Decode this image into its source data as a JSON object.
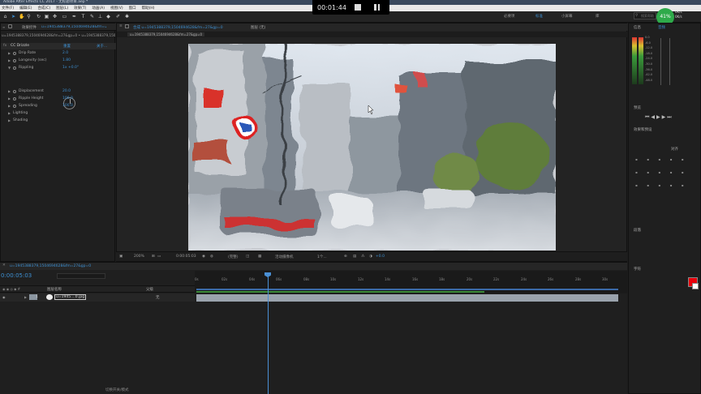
{
  "titlebar": {
    "title": "Adobe After Effects CC 2017 - 无标题项目.aep *"
  },
  "menu": [
    "文件(F)",
    "编辑(E)",
    "合成(C)",
    "图层(L)",
    "效果(T)",
    "动画(A)",
    "视图(V)",
    "窗口",
    "帮助(H)"
  ],
  "recorder": {
    "time": "00:01:44"
  },
  "toolbar": {
    "snap_label": "对齐",
    "workspaces": [
      "必要项",
      "标准",
      "小屏幕",
      "库"
    ],
    "search_placeholder": "搜索帮助"
  },
  "system": {
    "cpu": "41%",
    "net_up": "0K/s",
    "net_down": "0K/s"
  },
  "effect_controls": {
    "tab": "效果控件",
    "tab_file": "u=1945388379,1504694628&fm=27&gp=0",
    "breadcrumb": "u=1945388379,1504694628&fm=27&gp=0 • u=1945388379,1504694628&fm=27&gp=0",
    "effect_name": "CC Drizzle",
    "reset": "重置",
    "about": "关于...",
    "params": [
      {
        "name": "Drip Rate",
        "value": "2.0",
        "twirl": true,
        "stopwatch": true
      },
      {
        "name": "Longevity (sec)",
        "value": "1.80",
        "twirl": true,
        "stopwatch": true
      },
      {
        "name": "Rippling",
        "value": "1x +0.0°",
        "twirl": true,
        "stopwatch": true
      },
      {
        "name": "Displacement",
        "value": "20.0",
        "twirl": true,
        "stopwatch": true
      },
      {
        "name": "Ripple Height",
        "value": "100.0",
        "twirl": true,
        "stopwatch": true
      },
      {
        "name": "Spreading",
        "value": "100.0",
        "twirl": true,
        "stopwatch": true
      },
      {
        "name": "Lighting",
        "value": "",
        "twirl": true,
        "stopwatch": false
      },
      {
        "name": "Shading",
        "value": "",
        "twirl": true,
        "stopwatch": false
      }
    ]
  },
  "composition": {
    "tab": "合成 u=1945388379,1504694628&fm=27&gp=0",
    "layer_tab": "图层 (无)",
    "sub_tab": "u=1945388379,1504694628&fm=27&gp=0",
    "zoom": "200%",
    "timecode": "0:00:05:03",
    "resolution": "(完整)",
    "camera": "活动摄像机",
    "views": "1个...",
    "exposure": "+0.0"
  },
  "timeline": {
    "tab": "u=1945388379,1504694628&fm=27&gp=0",
    "timecode": "0:00:05:03",
    "col_layer": "图层名称",
    "col_parent": "父级",
    "layer": {
      "index": "1",
      "name": "u=1945....0.jpg",
      "parent": "无"
    },
    "ticks": [
      "0s",
      "02s",
      "04s",
      "06s",
      "08s",
      "10s",
      "12s",
      "14s",
      "16s",
      "18s",
      "20s",
      "22s",
      "24s",
      "26s",
      "28s",
      "30s"
    ],
    "footer": "切换开关/模式"
  },
  "right_panel": {
    "info": "信息",
    "audio": "音频",
    "db": [
      "0.0",
      "-6.0",
      "-12.0",
      "-18.0",
      "-24.0",
      "-30.0",
      "-36.0",
      "-42.0",
      "-48.0"
    ],
    "preview": "预览",
    "effects_presets": "效果和预设",
    "align": "对齐",
    "paragraph": "段落",
    "character": "字符",
    "accent_color": "#e8000b"
  }
}
